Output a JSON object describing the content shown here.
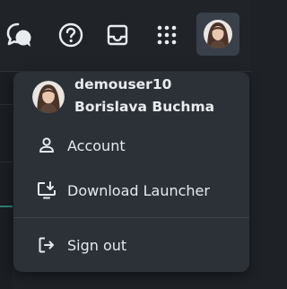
{
  "topbar": {
    "icons": [
      "chat-bubbles-icon",
      "help-icon",
      "inbox-icon",
      "apps-grid-icon",
      "user-avatar"
    ]
  },
  "user_menu": {
    "username": "demouser10",
    "full_name": "Borislava Buchma",
    "items": [
      {
        "label": "Account",
        "icon": "person-icon"
      },
      {
        "label": "Download Launcher",
        "icon": "download-monitor-icon"
      },
      {
        "label": "Sign out",
        "icon": "sign-out-icon"
      }
    ]
  },
  "colors": {
    "background": "#1e2227",
    "menu_background": "#2c3138",
    "text": "#e6e9ec",
    "avatar_button": "#3a4049"
  }
}
